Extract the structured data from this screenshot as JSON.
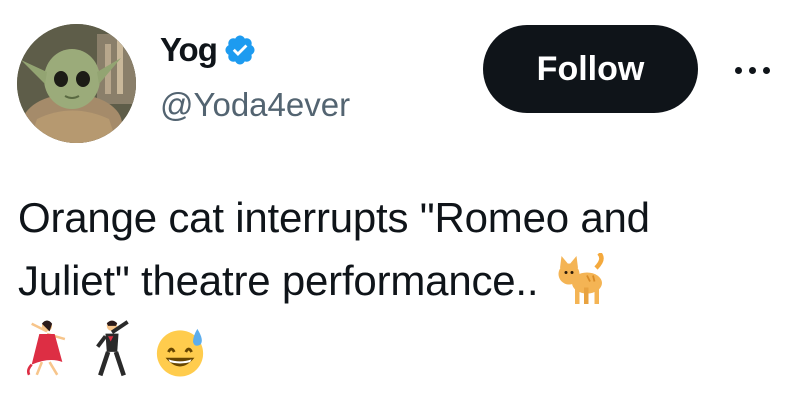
{
  "author": {
    "display_name": "Yog",
    "handle": "@Yoda4ever",
    "verified": true,
    "avatar_icon": "baby-yoda-avatar"
  },
  "actions": {
    "follow_label": "Follow",
    "more_icon": "more-horizontal-icon"
  },
  "tweet": {
    "text_line_1": "Orange cat interrupts \"Romeo and",
    "text_line_2": "Juliet\" theatre performance..",
    "emojis": [
      "cat-emoji",
      "woman-dancing-emoji",
      "man-dancing-emoji",
      "grinning-sweat-emoji"
    ]
  },
  "colors": {
    "follow_bg": "#0f1419",
    "verified_blue": "#1d9bf0",
    "handle_gray": "#536471"
  }
}
